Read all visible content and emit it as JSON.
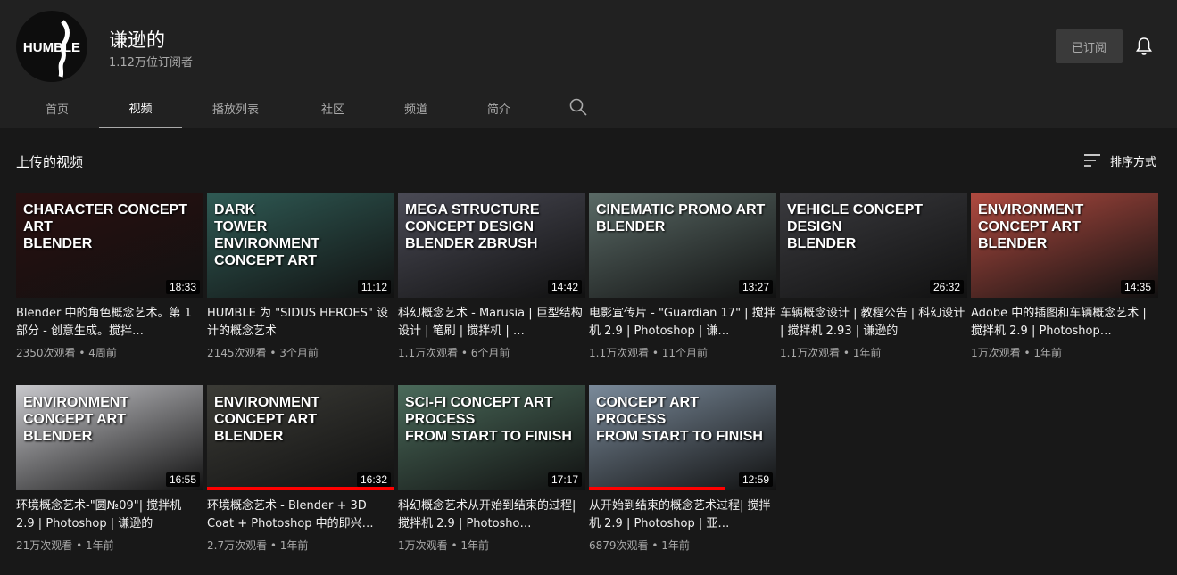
{
  "channel": {
    "avatar_text": "HUMBLE",
    "name": "谦逊的",
    "subscribers": "1.12万位订阅者",
    "subscribe_label": "已订阅"
  },
  "tabs": [
    "首页",
    "视频",
    "播放列表",
    "社区",
    "频道",
    "简介"
  ],
  "active_tab": "视频",
  "section": {
    "title": "上传的视频",
    "sort_label": "排序方式"
  },
  "videos": [
    {
      "thumb_text": "Character Concept Art\nblender",
      "duration": "18:33",
      "title": "Blender 中的角色概念艺术。第 1 部分 - 创意生成。搅拌…",
      "meta": "2350次观看 • 4周前",
      "color": "#2a1010"
    },
    {
      "thumb_text": "DARK\nTOWER\nENVIRONMENT\nCONCEPT ART",
      "duration": "11:12",
      "title": "HUMBLE 为 \"SIDUS HEROES\" 设计的概念艺术",
      "meta": "2145次观看 • 3个月前",
      "color": "#2f5a54"
    },
    {
      "thumb_text": "MEGA STRUCTURE\nCONCEPT DESIGN\nblender  ZBRUSH",
      "duration": "14:42",
      "title": "科幻概念艺术 - Marusia | 巨型结构设计 | 笔刷 | 搅拌机 | …",
      "meta": "1.1万次观看 • 6个月前",
      "color": "#4a4a55"
    },
    {
      "thumb_text": "CINEMATIC PROMO ART\nblender",
      "duration": "13:27",
      "title": "电影宣传片 - \"Guardian 17\" | 搅拌机 2.9 | Photoshop | 谦…",
      "meta": "1.1万次观看 • 11个月前",
      "color": "#5a6a66"
    },
    {
      "thumb_text": "VEHICLE CONCEPT\nDESIGN\nblender",
      "duration": "26:32",
      "title": "车辆概念设计 | 教程公告 | 科幻设计 | 搅拌机 2.93 | 谦逊的",
      "meta": "1.1万次观看 • 1年前",
      "color": "#3a3a3e"
    },
    {
      "thumb_text": "ENVIRONMENT\nCONCEPT ART\nblender",
      "duration": "14:35",
      "title": "Adobe 中的插图和车辆概念艺术 | 搅拌机 2.9 | Photoshop…",
      "meta": "1万次观看 • 1年前",
      "color": "#b04a40"
    },
    {
      "thumb_text": "ENVIRONMENT\nCONCEPT ART\nblender",
      "duration": "16:55",
      "title": "环境概念艺术-\"圆№09\"| 搅拌机 2.9 | Photoshop | 谦逊的",
      "meta": "21万次观看 • 1年前",
      "color": "#c8c8cc"
    },
    {
      "thumb_text": "ENVIRONMENT\nCONCEPT ART\nblender",
      "duration": "16:32",
      "title": "环境概念艺术 - Blender + 3D Coat + Photoshop 中的即兴…",
      "meta": "2.7万次观看 • 1年前",
      "color": "#3b3b36",
      "progress": 1.0
    },
    {
      "thumb_text": "SCI-FI CONCEPT ART PROCESS\nFROM START TO FINISH",
      "duration": "17:17",
      "title": "科幻概念艺术从开始到结束的过程| 搅拌机 2.9 | Photosho…",
      "meta": "1万次观看 • 1年前",
      "color": "#4a6a5a"
    },
    {
      "thumb_text": "Concept Art Process\nFrom Start to Finish",
      "duration": "12:59",
      "title": "从开始到结束的概念艺术过程| 搅拌机 2.9 | Photoshop | 亚…",
      "meta": "6879次观看 • 1年前",
      "color": "#7a8a9a",
      "progress": 0.73
    }
  ]
}
